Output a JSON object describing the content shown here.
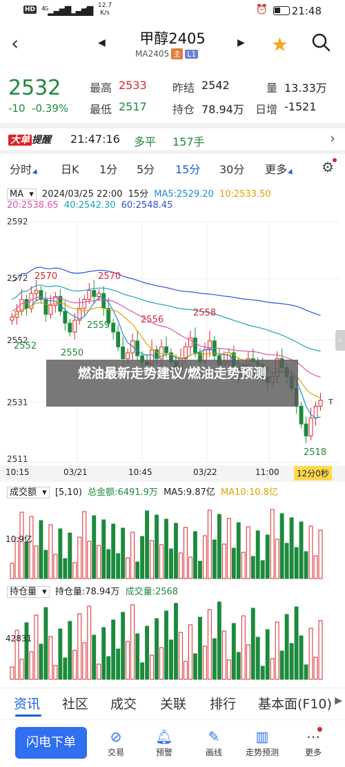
{
  "status_bar": {
    "network": "HD",
    "signal_1": "4G",
    "signal_2": "4G",
    "speed_value": "12.7",
    "speed_unit": "K/s",
    "time": "21:48"
  },
  "header": {
    "title": "甲醇2405",
    "code": "MA2405",
    "tag_main": "主",
    "tag_l1": "L1"
  },
  "quote": {
    "price": "2532",
    "change": "-10",
    "change_pct": "-0.39%",
    "high_label": "最高",
    "high": "2533",
    "low_label": "最低",
    "low": "2517",
    "prev_settle_label": "昨结",
    "prev_settle": "2542",
    "open_interest_label": "持仓",
    "open_interest": "78.94万",
    "volume_label": "量",
    "volume": "13.33万",
    "daily_change_label": "日增",
    "daily_change": "-1521"
  },
  "ribbon": {
    "logo_a": "大单",
    "logo_b": "提醒",
    "time": "21:47:16",
    "direction": "多平",
    "hands": "157手"
  },
  "tabs": [
    "分时",
    "日K",
    "1分",
    "5分",
    "15分",
    "30分",
    "更多"
  ],
  "active_tab": "15分",
  "chart": {
    "ma_selector": "MA",
    "datetime": "2024/03/25 22:00",
    "period": "15分",
    "ma5": "MA5:2529.20",
    "ma10": "10:2533.50",
    "ma20": "20:2538.65",
    "ma40": "40:2542.30",
    "ma60": "60:2548.45",
    "y_ticks": [
      "2592",
      "2572",
      "2552",
      "2531",
      "2511"
    ],
    "time_ticks": [
      "10:15",
      "03/21",
      "10:45",
      "03/22",
      "11:00"
    ],
    "countdown": "12分0秒",
    "annotations": [
      "2570",
      "2570",
      "2559",
      "2556",
      "2558",
      "2550",
      "2552",
      "2518"
    ],
    "last_marker": "T",
    "colors": {
      "ma5": "#1a8bd6",
      "ma10": "#e0a100",
      "ma20": "#e052a8",
      "ma40": "#17a2b8",
      "ma60": "#2d4fd6",
      "up": "#d9262b",
      "down": "#1c8a3c"
    }
  },
  "volume_panel": {
    "selector": "成交额",
    "params": "[5,10)",
    "total_label": "总金额:6491.9万",
    "ma5": "MA5:9.87亿",
    "ma10": "MA10:10.8亿",
    "y_tick": "10.9亿"
  },
  "oi_panel": {
    "selector": "持仓量",
    "oi_label": "持仓量:78.94万",
    "vol_label": "成交量:2568",
    "y_tick": "42831"
  },
  "subnav": [
    "资讯",
    "社区",
    "成交",
    "关联",
    "排行",
    "基本面(F10)"
  ],
  "bottom_bar": {
    "primary": "闪电下单",
    "items": [
      {
        "label": "交易",
        "icon": "trade-icon"
      },
      {
        "label": "预警",
        "icon": "bell-icon"
      },
      {
        "label": "画线",
        "icon": "pen-icon"
      },
      {
        "label": "走势预测",
        "icon": "forecast-icon"
      },
      {
        "label": "更多",
        "icon": "more-icon"
      }
    ]
  },
  "overlay": {
    "text": "燃油最新走势建议/燃油走势预测"
  }
}
